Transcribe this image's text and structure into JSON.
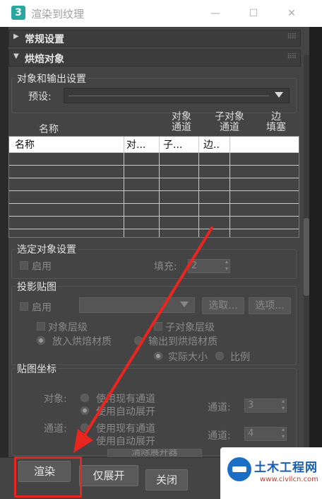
{
  "window": {
    "title": "渲染到纹理",
    "app_icon": "3",
    "minimize": "—",
    "maximize": "☐",
    "close": "✕"
  },
  "rollouts": {
    "general": "常规设置",
    "bake": "烘焙对象"
  },
  "object_output": {
    "title": "对象和输出设置",
    "preset_label": "预设:"
  },
  "table": {
    "headers_top": {
      "name": "名称",
      "obj_channel": "对象\n通道",
      "sub_channel": "子对象\n通道",
      "edge_pad": "边\n填塞"
    },
    "row_header": [
      "名称",
      "对...",
      "子...",
      "边.."
    ]
  },
  "selected_settings": {
    "title": "选定对象设置",
    "enable": "启用",
    "padding_label": "填充:",
    "padding_value": "2"
  },
  "projection": {
    "title": "投影贴图",
    "enable": "启用",
    "pick_button": "选取...",
    "options_button": "选项...",
    "object_level": "对象层级",
    "subobject_level": "子对象层级",
    "put_bake_material": "放入烘焙材质",
    "output_bake_material": "输出到烘焙材质",
    "actual_size": "实际大小",
    "proportional": "比例"
  },
  "mapping": {
    "title": "贴图坐标",
    "object_label": "对象:",
    "channel_label": "通道:",
    "use_existing": "使用现有通道",
    "use_auto_unwrap": "使用自动展开",
    "channel_value_1": "3",
    "channel_value_2": "4",
    "channel_label_2": "通道:",
    "channel_label_3": "通道:",
    "clear_button": "清除展开器"
  },
  "footer": {
    "render": "渲染",
    "unwrap_only": "仅展开",
    "close": "关闭"
  },
  "watermark": {
    "title": "土木工程网",
    "url": "www.civilcn.com"
  },
  "colors": {
    "highlight": "#e8261f",
    "brand": "#1a6fc4"
  }
}
